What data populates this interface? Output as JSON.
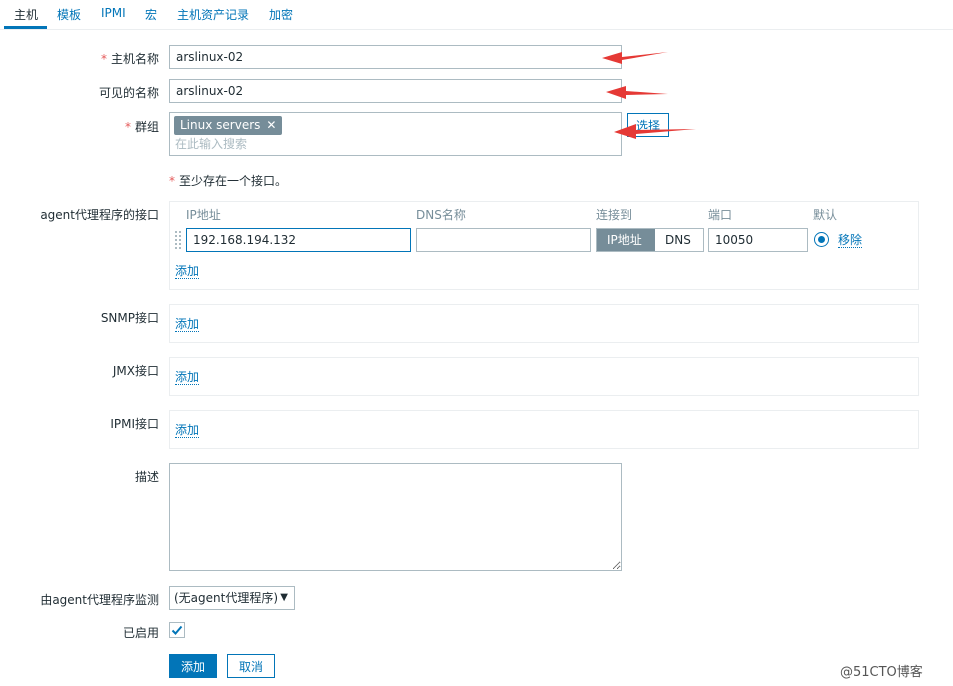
{
  "tabs": [
    "主机",
    "模板",
    "IPMI",
    "宏",
    "主机资产记录",
    "加密"
  ],
  "form": {
    "host_name_label": "主机名称",
    "host_name_value": "arslinux-02",
    "visible_name_label": "可见的名称",
    "visible_name_value": "arslinux-02",
    "groups_label": "群组",
    "group_chip": "Linux servers",
    "group_search_placeholder": "在此输入搜索",
    "select_button": "选择",
    "required_mark": "*",
    "interface_notice": "至少存在一个接口。"
  },
  "agent_interface": {
    "label": "agent代理程序的接口",
    "col_ip": "IP地址",
    "col_dns": "DNS名称",
    "col_connect": "连接到",
    "col_port": "端口",
    "col_default": "默认",
    "ip_value": "192.168.194.132",
    "dns_value": "",
    "connect_ip": "IP地址",
    "connect_dns": "DNS",
    "port_value": "10050",
    "remove_link": "移除",
    "add_link": "添加"
  },
  "snmp": {
    "label": "SNMP接口",
    "add_link": "添加"
  },
  "jmx": {
    "label": "JMX接口",
    "add_link": "添加"
  },
  "ipmi": {
    "label": "IPMI接口",
    "add_link": "添加"
  },
  "description": {
    "label": "描述",
    "value": ""
  },
  "proxy": {
    "label": "由agent代理程序监测",
    "selected": "(无agent代理程序)"
  },
  "enabled": {
    "label": "已启用",
    "checked": true
  },
  "buttons": {
    "add": "添加",
    "cancel": "取消"
  },
  "watermark": "@51CTO博客",
  "colors": {
    "accent": "#0275b8",
    "required": "#e45959",
    "annotation_arrow": "#e53935",
    "chip": "#768d99"
  },
  "icons": {
    "chip_remove": "close-icon",
    "enabled_check": "check-icon",
    "drag_handle": "drag-handle-icon",
    "dropdown": "caret-down-icon"
  }
}
